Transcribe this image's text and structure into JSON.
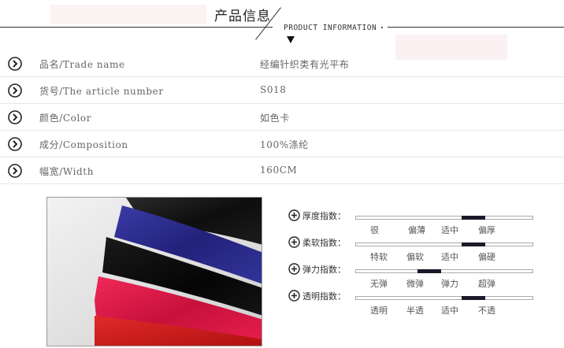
{
  "header": {
    "title": "产品信息",
    "subtitle": "PRODUCT INFORMATION"
  },
  "info_rows": [
    {
      "label": "品名/Trade name",
      "value": "经编针织类有光平布",
      "icon": "circle-arrow-right-icon"
    },
    {
      "label": "货号/The article number",
      "value": "S018",
      "icon": "circle-arrow-right-icon"
    },
    {
      "label": "颜色/Color",
      "value": "如色卡",
      "icon": "circle-arrow-right-icon"
    },
    {
      "label": "成分/Composition",
      "value": "100%涤纶",
      "icon": "circle-arrow-right-icon"
    },
    {
      "label": "幅宽/Width",
      "value": "160CM",
      "icon": "circle-arrow-right-icon"
    }
  ],
  "indices": [
    {
      "name": "厚度指数：",
      "options": [
        "很",
        "偏薄",
        "适中",
        "偏厚"
      ],
      "selected": 2
    },
    {
      "name": "柔软指数：",
      "options": [
        "特软",
        "偏软",
        "适中",
        "偏硬"
      ],
      "selected": 2
    },
    {
      "name": "弹力指数：",
      "options": [
        "无弹",
        "微弹",
        "弹力",
        "超弹"
      ],
      "selected": 1
    },
    {
      "name": "透明指数：",
      "options": [
        "透明",
        "半透",
        "适中",
        "不透"
      ],
      "selected": 2
    }
  ],
  "photo": {
    "subject": "fabric swatches",
    "colors": [
      "#111111",
      "#2a2a8a",
      "#0c0c0c",
      "#e8174a",
      "#d81a20"
    ]
  }
}
